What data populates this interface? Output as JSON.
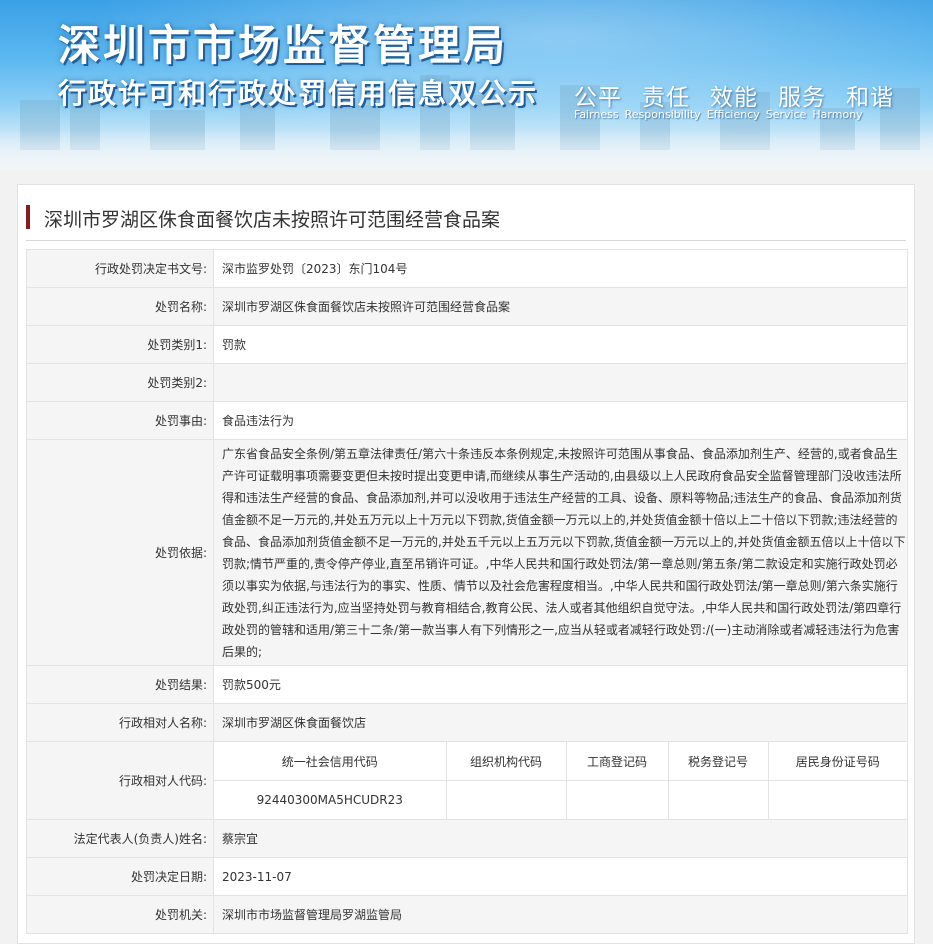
{
  "header": {
    "title": "深圳市市场监督管理局",
    "subtitle": "行政许可和行政处罚信用信息双公示",
    "slogan_cn": [
      "公平",
      "责任",
      "效能",
      "服务",
      "和谐"
    ],
    "slogan_en": [
      "Fairness",
      "Responsibility",
      "Efficiency",
      "Service",
      "Harmony"
    ]
  },
  "case": {
    "title": "深圳市罗湖区侏食面餐饮店未按照许可范围经营食品案",
    "rows": [
      {
        "label": "行政处罚决定书文号:",
        "value": "深市监罗处罚〔2023〕东门104号"
      },
      {
        "label": "处罚名称:",
        "value": "深圳市罗湖区侏食面餐饮店未按照许可范围经营食品案"
      },
      {
        "label": "处罚类别1:",
        "value": "罚款"
      },
      {
        "label": "处罚类别2:",
        "value": ""
      },
      {
        "label": "处罚事由:",
        "value": "食品违法行为"
      },
      {
        "label": "处罚依据:",
        "value": "广东省食品安全条例/第五章法律责任/第六十条违反本条例规定,未按照许可范围从事食品、食品添加剂生产、经营的,或者食品生产许可证载明事项需要变更但未按时提出变更申请,而继续从事生产活动的,由县级以上人民政府食品安全监督管理部门没收违法所得和违法生产经营的食品、食品添加剂,并可以没收用于违法生产经营的工具、设备、原料等物品;违法生产的食品、食品添加剂货值金额不足一万元的,并处五万元以上十万元以下罚款,货值金额一万元以上的,并处货值金额十倍以上二十倍以下罚款;违法经营的食品、食品添加剂货值金额不足一万元的,并处五千元以上五万元以下罚款,货值金额一万元以上的,并处货值金额五倍以上十倍以下罚款;情节严重的,责令停产停业,直至吊销许可证。,中华人民共和国行政处罚法/第一章总则/第五条/第二款设定和实施行政处罚必须以事实为依据,与违法行为的事实、性质、情节以及社会危害程度相当。,中华人民共和国行政处罚法/第一章总则/第六条实施行政处罚,纠正违法行为,应当坚持处罚与教育相结合,教育公民、法人或者其他组织自觉守法。,中华人民共和国行政处罚法/第四章行政处罚的管辖和适用/第三十二条/第一款当事人有下列情形之一,应当从轻或者减轻行政处罚:/(一)主动消除或者减轻违法行为危害后果的;"
      },
      {
        "label": "处罚结果:",
        "value": "罚款500元"
      },
      {
        "label": "行政相对人名称:",
        "value": "深圳市罗湖区侏食面餐饮店"
      }
    ],
    "codes": {
      "label": "行政相对人代码:",
      "headers": [
        "统一社会信用代码",
        "组织机构代码",
        "工商登记码",
        "税务登记号",
        "居民身份证号码"
      ],
      "values": [
        "92440300MA5HCUDR23",
        "",
        "",
        "",
        ""
      ]
    },
    "rows_after": [
      {
        "label": "法定代表人(负责人)姓名:",
        "value": "蔡宗宜"
      },
      {
        "label": "处罚决定日期:",
        "value": "2023-11-07"
      },
      {
        "label": "处罚机关:",
        "value": "深圳市市场监督管理局罗湖监管局"
      }
    ]
  }
}
